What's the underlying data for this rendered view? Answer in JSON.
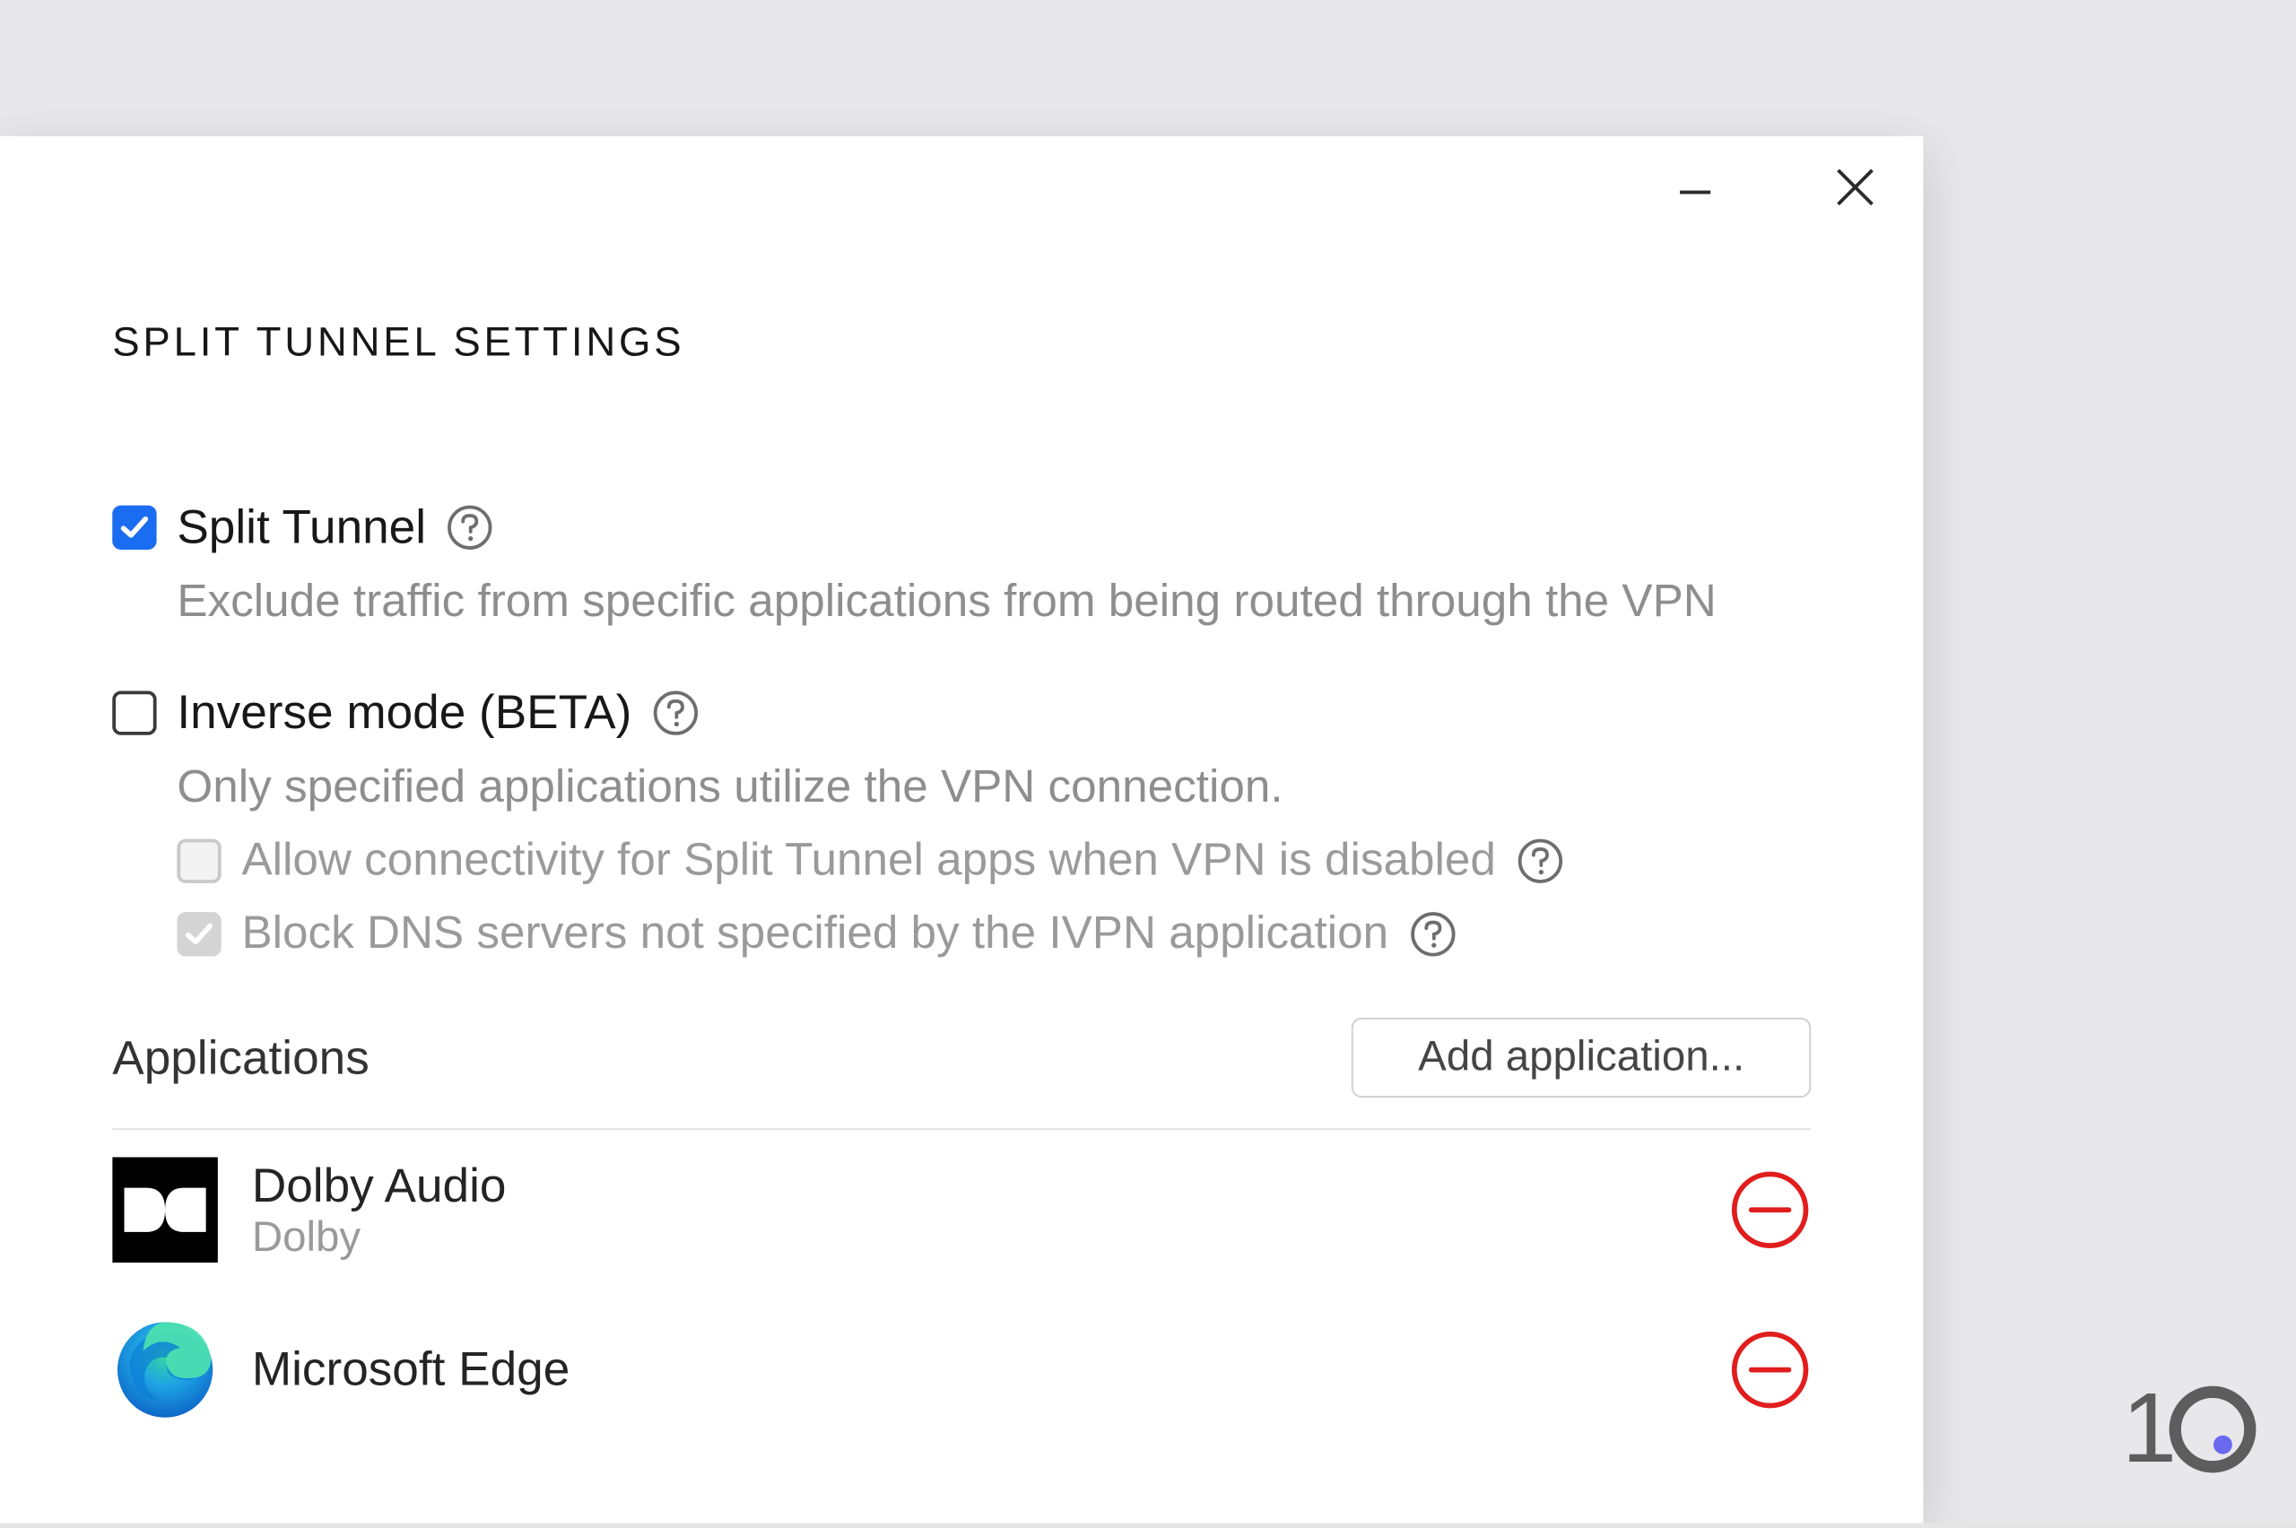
{
  "window": {
    "title": "SPLIT TUNNEL SETTINGS"
  },
  "settings": {
    "splitTunnel": {
      "label": "Split Tunnel",
      "checked": true,
      "description": "Exclude traffic from specific applications from being routed through the VPN"
    },
    "inverseMode": {
      "label": "Inverse mode (BETA)",
      "checked": false,
      "description": "Only specified applications utilize the VPN connection.",
      "subOptions": {
        "allowConnectivity": {
          "label": "Allow connectivity for Split Tunnel apps when VPN is disabled",
          "checked": false,
          "disabled": true
        },
        "blockDns": {
          "label": "Block DNS servers not specified by the IVPN application",
          "checked": true,
          "disabled": true
        }
      }
    }
  },
  "applications": {
    "title": "Applications",
    "addButtonLabel": "Add application...",
    "items": [
      {
        "name": "Dolby Audio",
        "vendor": "Dolby",
        "iconType": "dolby"
      },
      {
        "name": "Microsoft Edge",
        "vendor": "",
        "iconType": "edge"
      }
    ]
  },
  "watermark": {
    "text": "10"
  }
}
